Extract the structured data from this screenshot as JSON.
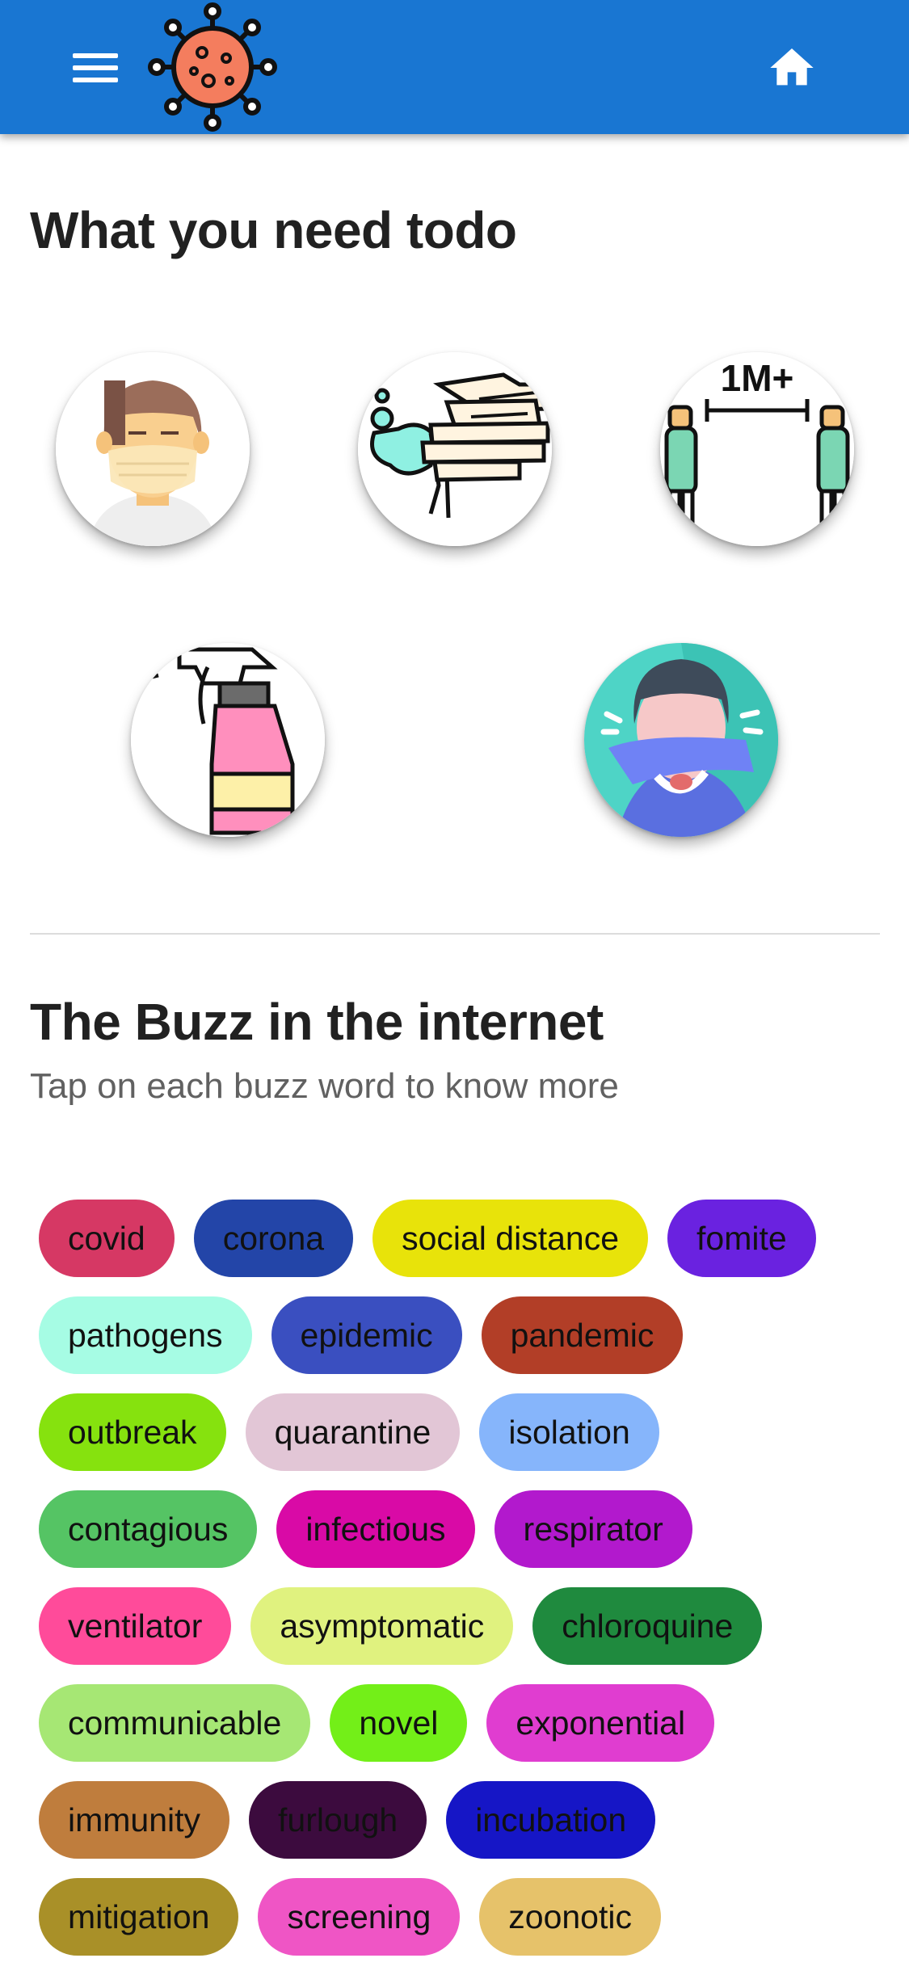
{
  "app_bar": {
    "menu_icon": "hamburger-menu-icon",
    "logo_icon": "virus-logo-icon",
    "home_icon": "home-icon",
    "color": "#1976d2"
  },
  "todo_section": {
    "title": "What you need todo",
    "items": [
      {
        "icon": "face-mask-icon"
      },
      {
        "icon": "hand-washing-icon"
      },
      {
        "icon": "social-distance-icon",
        "label": "1M+"
      },
      {
        "icon": "disinfectant-spray-icon"
      },
      {
        "icon": "cough-into-elbow-icon"
      }
    ]
  },
  "buzz_section": {
    "title": "The Buzz in the internet",
    "subtitle": "Tap on each buzz word to know more",
    "rows": [
      [
        {
          "label": "covid",
          "color": "#d63864"
        },
        {
          "label": "corona",
          "color": "#2345a8"
        },
        {
          "label": "social distance",
          "color": "#e8e30a"
        },
        {
          "label": "fomite",
          "color": "#6a22e0"
        }
      ],
      [
        {
          "label": "pathogens",
          "color": "#a6fce4"
        },
        {
          "label": "epidemic",
          "color": "#3a4fc0"
        },
        {
          "label": "pandemic",
          "color": "#b23e27"
        }
      ],
      [
        {
          "label": "outbreak",
          "color": "#86e20e"
        },
        {
          "label": "quarantine",
          "color": "#e2c6d6"
        },
        {
          "label": "isolation",
          "color": "#86b5fb"
        }
      ],
      [
        {
          "label": "contagious",
          "color": "#55c464"
        },
        {
          "label": "infectious",
          "color": "#d90aa6"
        },
        {
          "label": "respirator",
          "color": "#b219cd"
        }
      ],
      [
        {
          "label": "ventilator",
          "color": "#ff4b9a"
        },
        {
          "label": "asymptomatic",
          "color": "#e0f27f"
        },
        {
          "label": "chloroquine",
          "color": "#1f8a3e"
        }
      ],
      [
        {
          "label": "communicable",
          "color": "#a6e774"
        },
        {
          "label": "novel",
          "color": "#73ef18"
        },
        {
          "label": "exponential",
          "color": "#e03dd0"
        }
      ],
      [
        {
          "label": "immunity",
          "color": "#bf7d3d"
        },
        {
          "label": "furlough",
          "color": "#3c0b3e"
        },
        {
          "label": "incubation",
          "color": "#1616c6"
        }
      ],
      [
        {
          "label": "mitigation",
          "color": "#a99028"
        },
        {
          "label": "screening",
          "color": "#ef55c5"
        },
        {
          "label": "zoonotic",
          "color": "#e6c26a"
        }
      ]
    ]
  }
}
